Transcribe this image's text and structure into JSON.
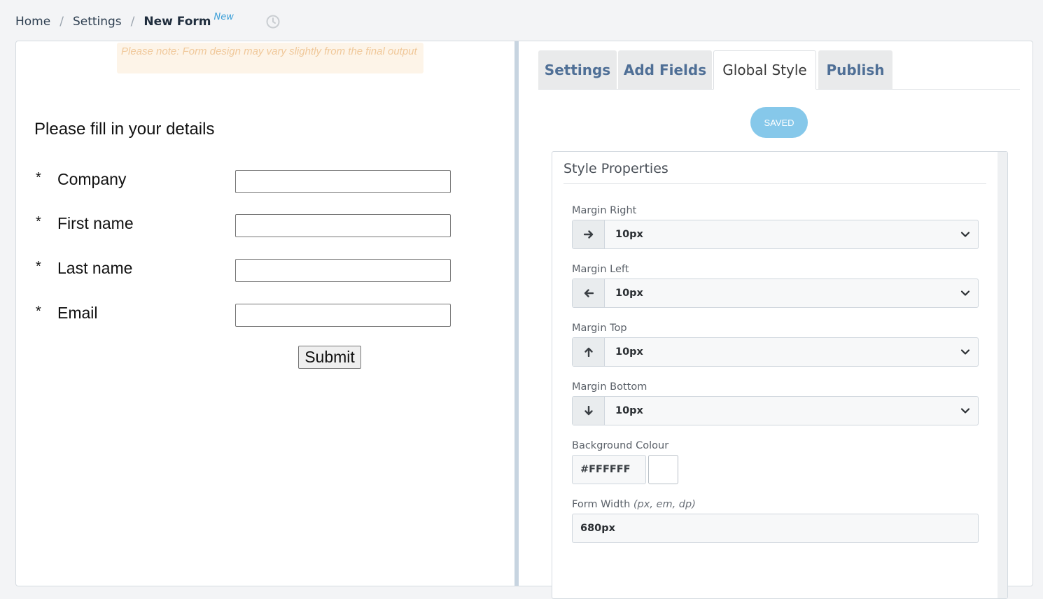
{
  "breadcrumb": {
    "home": "Home",
    "separator": "/",
    "settings": "Settings",
    "current": "New Form",
    "badge": "New"
  },
  "preview": {
    "note": "Please note: Form design may vary slightly from the final output",
    "title": "Please fill in your details",
    "required_marker": "*",
    "fields": [
      {
        "label": "Company",
        "value": ""
      },
      {
        "label": "First name",
        "value": ""
      },
      {
        "label": "Last name",
        "value": ""
      },
      {
        "label": "Email",
        "value": ""
      }
    ],
    "submit_label": "Submit"
  },
  "tabs": [
    {
      "label": "Settings",
      "active": false
    },
    {
      "label": "Add Fields",
      "active": false
    },
    {
      "label": "Global Style",
      "active": true
    },
    {
      "label": "Publish",
      "active": false
    }
  ],
  "saved_label": "SAVED",
  "style_properties": {
    "title": "Style Properties",
    "margin_right": {
      "label": "Margin Right",
      "value": "10px",
      "icon": "arrow-right-icon"
    },
    "margin_left": {
      "label": "Margin Left",
      "value": "10px",
      "icon": "arrow-left-icon"
    },
    "margin_top": {
      "label": "Margin Top",
      "value": "10px",
      "icon": "arrow-up-icon"
    },
    "margin_bottom": {
      "label": "Margin Bottom",
      "value": "10px",
      "icon": "arrow-down-icon"
    },
    "background_colour": {
      "label": "Background Colour",
      "value": "#FFFFFF"
    },
    "form_width": {
      "label": "Form Width",
      "hint": "(px, em, dp)",
      "value": "680px"
    }
  },
  "colors": {
    "accent": "#3ea0d8",
    "saved_button": "#86c8ea",
    "tab_text": "#4f6f96",
    "background_swatch": "#FFFFFF"
  }
}
